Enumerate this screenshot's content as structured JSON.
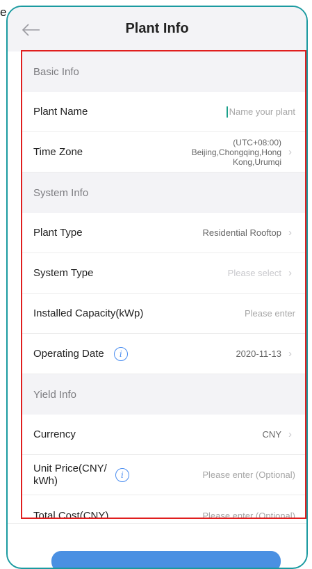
{
  "edge_text": "e",
  "header": {
    "title": "Plant Info",
    "back_icon": "back-arrow-icon"
  },
  "sections": {
    "basic": {
      "title": "Basic Info"
    },
    "system": {
      "title": "System Info"
    },
    "yield": {
      "title": "Yield Info"
    }
  },
  "fields": {
    "plant_name": {
      "label": "Plant Name",
      "placeholder": "Name your plant"
    },
    "time_zone": {
      "label": "Time Zone",
      "value_line1": "(UTC+08:00)",
      "value_line2": "Beijing,Chongqing,Hong",
      "value_line3": "Kong,Urumqi"
    },
    "plant_type": {
      "label": "Plant Type",
      "value": "Residential Rooftop"
    },
    "system_type": {
      "label": "System Type",
      "placeholder": "Please select"
    },
    "installed_capacity": {
      "label": "Installed Capacity(kWp)",
      "placeholder": "Please enter"
    },
    "operating_date": {
      "label": "Operating Date",
      "value": "2020-11-13"
    },
    "currency": {
      "label": "Currency",
      "value": "CNY"
    },
    "unit_price": {
      "label_line1": "Unit Price(CNY/",
      "label_line2": "kWh)",
      "placeholder": "Please enter (Optional)"
    },
    "total_cost": {
      "label": "Total Cost(CNY)",
      "placeholder": "Please enter (Optional)"
    }
  },
  "colors": {
    "accent_teal": "#1a9aa0",
    "highlight_red": "#e01e1e",
    "primary_blue": "#4a90e2",
    "info_blue": "#4a8df0"
  }
}
